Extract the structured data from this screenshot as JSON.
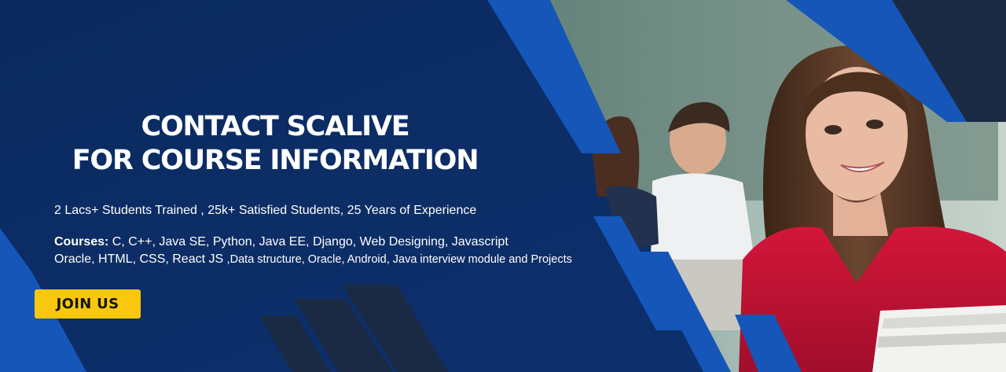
{
  "banner": {
    "headline_line1": "CONTACT SCALIVE",
    "headline_line2": "FOR COURSE INFORMATION",
    "stats": "2 Lacs+ Students Trained , 25k+ Satisfied Students, 25 Years of Experience",
    "courses_label": "Courses:",
    "courses_line1": " C, C++, Java SE, Python, Java EE, Django, Web Designing, Javascript",
    "courses_line2_a": "Oracle, HTML, CSS, React JS ",
    "courses_line2_b": ",Data structure, Oracle, Android, Java interview module and Projects",
    "join_label": "JOIN US"
  },
  "colors": {
    "background_navy": "#0c2b63",
    "accent_blue": "#1556b8",
    "dark_slate": "#1b2a44",
    "button_yellow": "#f9c80e",
    "text_white": "#ffffff"
  },
  "photo": {
    "subject": "smiling-student-photo",
    "description_icons": [
      "student-photo"
    ]
  }
}
